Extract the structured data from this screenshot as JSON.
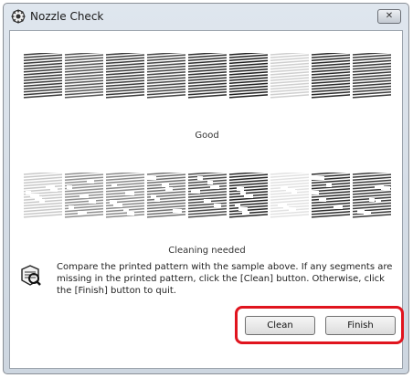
{
  "window": {
    "title": "Nozzle Check",
    "app_icon": "printer-gear-icon",
    "close_icon": "close-icon",
    "close_glyph": "✕"
  },
  "patterns": {
    "good": {
      "caption": "Good",
      "segments": [
        "#3a3a3a",
        "#555555",
        "#3a3a3a",
        "#454545",
        "#2f2f2f",
        "#1f1f1f",
        "#cfcfcf",
        "#2a2a2a",
        "#3a3a3a"
      ]
    },
    "clogged": {
      "caption": "Cleaning needed",
      "segments": [
        "#c8c8c8",
        "#909090",
        "#8a8a8a",
        "#707070",
        "#4a4a4a",
        "#262626",
        "#e2e2e2",
        "#2e2e2e",
        "#3a3a3a"
      ]
    }
  },
  "info": {
    "icon": "pattern-check-icon",
    "text": "Compare the printed pattern with the sample above. If any segments are missing in the printed pattern, click the [Clean] button. Otherwise, click the [Finish] button to quit."
  },
  "buttons": {
    "clean_label": "Clean",
    "finish_label": "Finish",
    "highlight_color": "#e0141e"
  }
}
